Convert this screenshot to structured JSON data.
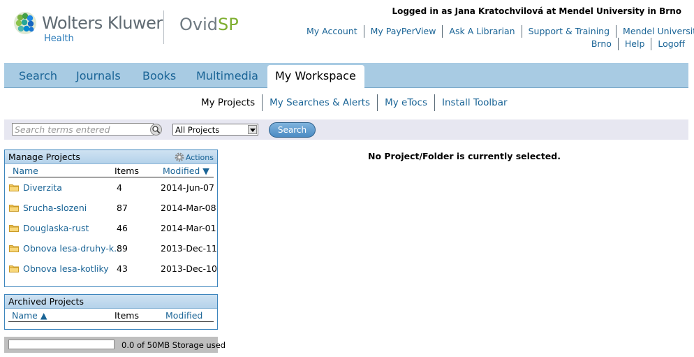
{
  "brand": {
    "company": "Wolters Kluwer",
    "division": "Health",
    "product_prefix": "Ovid",
    "product_suffix": "SP"
  },
  "session": {
    "logged_in_text": "Logged in as Jana Kratochvilová at Mendel University in Brno"
  },
  "top_links": [
    "My Account",
    "My PayPerView",
    "Ask A Librarian",
    "Support & Training",
    "Mendel University in",
    "Brno",
    "Help",
    "Logoff"
  ],
  "nav": {
    "tabs": [
      "Search",
      "Journals",
      "Books",
      "Multimedia",
      "My Workspace"
    ],
    "active": "My Workspace"
  },
  "subnav": {
    "items": [
      "My Projects",
      "My Searches & Alerts",
      "My eTocs",
      "Install Toolbar"
    ],
    "active": "My Projects"
  },
  "search": {
    "placeholder": "Search terms entered",
    "scope_selected": "All Projects",
    "button_label": "Search"
  },
  "manage_projects": {
    "title": "Manage Projects",
    "actions_label": "Actions",
    "columns": {
      "name": "Name",
      "items": "Items",
      "modified": "Modified ▼"
    },
    "rows": [
      {
        "name": "Diverzita",
        "items": "4",
        "modified": "2014-Jun-07"
      },
      {
        "name": "Srucha-slozeni",
        "items": "87",
        "modified": "2014-Mar-08"
      },
      {
        "name": "Douglaska-rust",
        "items": "46",
        "modified": "2014-Mar-01"
      },
      {
        "name": "Obnova lesa-druhy-k...",
        "items": "89",
        "modified": "2013-Dec-11"
      },
      {
        "name": "Obnova lesa-kotliky",
        "items": "43",
        "modified": "2013-Dec-10"
      }
    ]
  },
  "archived_projects": {
    "title": "Archived Projects",
    "columns": {
      "name": "Name ▲",
      "items": "Items",
      "modified": "Modified"
    }
  },
  "main": {
    "empty_message": "No Project/Folder is currently selected."
  },
  "storage": {
    "used_fraction": 0,
    "text": "0.0 of 50MB Storage used"
  },
  "colors": {
    "link": "#1a6496",
    "nav_bg": "#a8cbe3",
    "panel_border": "#3d85bd",
    "search_bar_bg": "#e7e7f1"
  }
}
